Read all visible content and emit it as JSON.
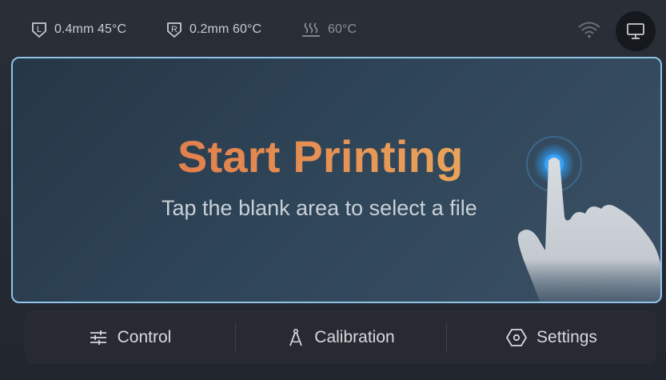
{
  "status": {
    "left_nozzle": {
      "icon": "left-nozzle-icon",
      "letter": "L",
      "text": "0.4mm 45°C"
    },
    "right_nozzle": {
      "icon": "right-nozzle-icon",
      "letter": "R",
      "text": "0.2mm 60°C"
    },
    "bed": {
      "icon": "heated-bed-icon",
      "text": "60°C"
    },
    "wifi_icon": "wifi-icon",
    "monitor_icon": "monitor-icon"
  },
  "main": {
    "title": "Start Printing",
    "subtitle": "Tap the blank area to select a file",
    "hand_icon": "tap-hand-icon"
  },
  "nav": {
    "control": {
      "label": "Control",
      "icon": "sliders-icon"
    },
    "calibration": {
      "label": "Calibration",
      "icon": "compass-icon"
    },
    "settings": {
      "label": "Settings",
      "icon": "hexagon-settings-icon"
    }
  },
  "colors": {
    "accent_border": "#8fc4ea",
    "title_gradient_start": "#e27f4d",
    "title_gradient_end": "#e9a35b",
    "tap_glow": "#2f8fdc"
  }
}
